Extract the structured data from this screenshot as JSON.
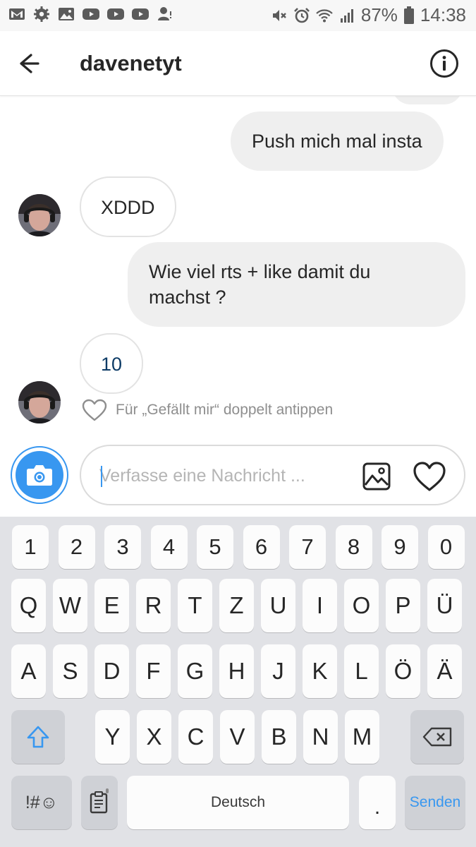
{
  "status_bar": {
    "battery": "87%",
    "time": "14:38"
  },
  "header": {
    "username": "davenetyt"
  },
  "messages": [
    {
      "direction": "out",
      "text": "Push mich mal insta"
    },
    {
      "direction": "in",
      "text": "XDDD"
    },
    {
      "direction": "out",
      "text_lines": [
        "Wie viel rts + like damit du",
        "machst ?"
      ]
    },
    {
      "direction": "in",
      "text": "10"
    }
  ],
  "like_hint": "Für „Gefällt mir“ doppelt antippen",
  "composer": {
    "placeholder": "Verfasse eine Nachricht ..."
  },
  "keyboard": {
    "row_numbers": [
      "1",
      "2",
      "3",
      "4",
      "5",
      "6",
      "7",
      "8",
      "9",
      "0"
    ],
    "row_1": [
      "Q",
      "W",
      "E",
      "R",
      "T",
      "Z",
      "U",
      "I",
      "O",
      "P",
      "Ü"
    ],
    "row_2": [
      "A",
      "S",
      "D",
      "F",
      "G",
      "H",
      "J",
      "K",
      "L",
      "Ö",
      "Ä"
    ],
    "row_3": [
      "Y",
      "X",
      "C",
      "V",
      "B",
      "N",
      "M"
    ],
    "symbols_label": "!#☺",
    "space_label": "Deutsch",
    "period_label": ".",
    "send_label": "Senden"
  },
  "colors": {
    "accent": "#3897f0",
    "outgoing_bubble": "#efefef",
    "keyboard_bg": "#e1e2e6"
  }
}
